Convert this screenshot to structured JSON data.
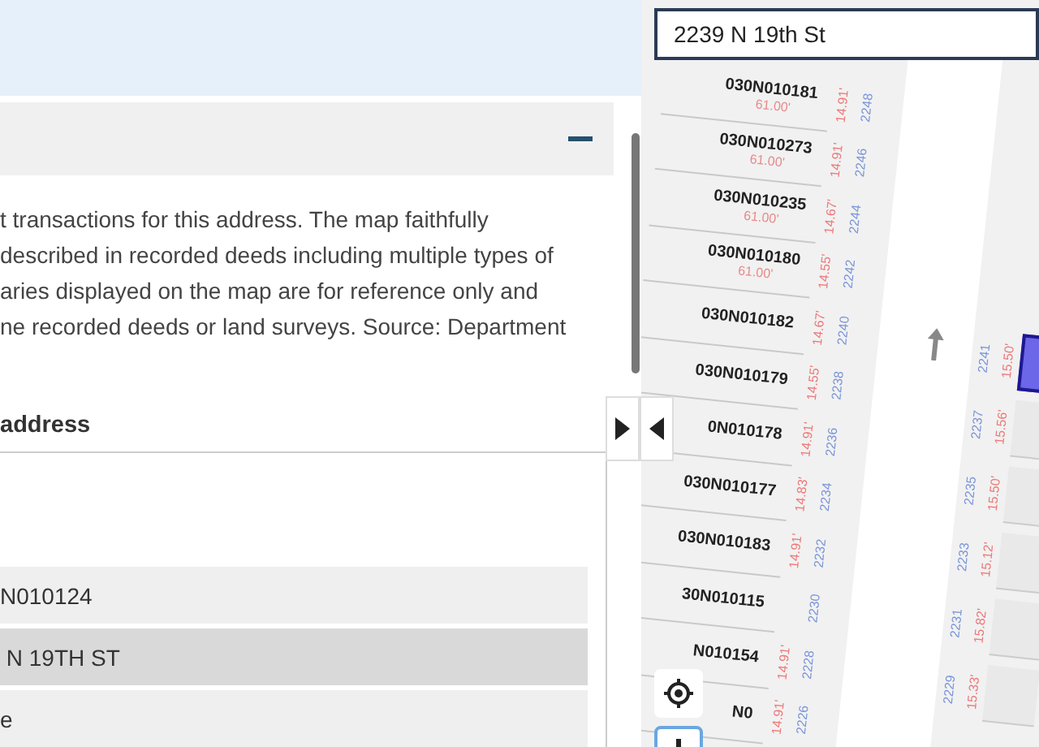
{
  "panel": {
    "description_lines": [
      "t transactions for this address. The map faithfully",
      "described in recorded deeds including multiple types of",
      "aries displayed on the map are for reference only and",
      "ne recorded deeds or land surveys. Source: Department"
    ],
    "section_heading": "address",
    "rows": [
      {
        "text": "N010124",
        "selected": false
      },
      {
        "text": " N 19TH ST",
        "selected": true
      },
      {
        "text": "e",
        "selected": false
      }
    ]
  },
  "map": {
    "search": {
      "value": "2239 N 19th St"
    },
    "parcels_left": [
      {
        "id": "030N010181",
        "frontage": "61.00'",
        "depth": "14.91'",
        "number": "2248"
      },
      {
        "id": "030N010273",
        "frontage": "61.00'",
        "depth": "14.91'",
        "number": "2246"
      },
      {
        "id": "030N010235",
        "frontage": "61.00'",
        "depth": "14.67'",
        "number": "2244"
      },
      {
        "id": "030N010180",
        "frontage": "61.00'",
        "depth": "14.55'",
        "number": "2242"
      },
      {
        "id": "030N010182",
        "depth": "14.67'",
        "number": "2240"
      },
      {
        "id": "030N010179",
        "depth": "14.55'",
        "number": "2238"
      },
      {
        "id": "0N010178",
        "depth": "14.91'",
        "number": "2236"
      },
      {
        "id": "030N010177",
        "depth": "14.83'",
        "number": "2234"
      },
      {
        "id": "030N010183",
        "depth": "14.91'",
        "number": "2232"
      },
      {
        "id": "30N010115",
        "number": "2230"
      },
      {
        "id": "N010154",
        "depth": "14.91'",
        "number": "2228"
      },
      {
        "id": "N0",
        "depth": "14.91'",
        "number": "2226"
      }
    ],
    "parcels_right": [
      {
        "number": "2241",
        "depth": "15.50'",
        "selected": true
      },
      {
        "number": "2237",
        "depth": "15.56'",
        "selected": false
      },
      {
        "number": "2235",
        "depth": "15.50'",
        "selected": false
      },
      {
        "number": "2233",
        "depth": "15.12'",
        "selected": false
      },
      {
        "number": "2231",
        "depth": "15.82'",
        "selected": false
      },
      {
        "number": "2229",
        "depth": "15.33'",
        "selected": false
      }
    ]
  }
}
